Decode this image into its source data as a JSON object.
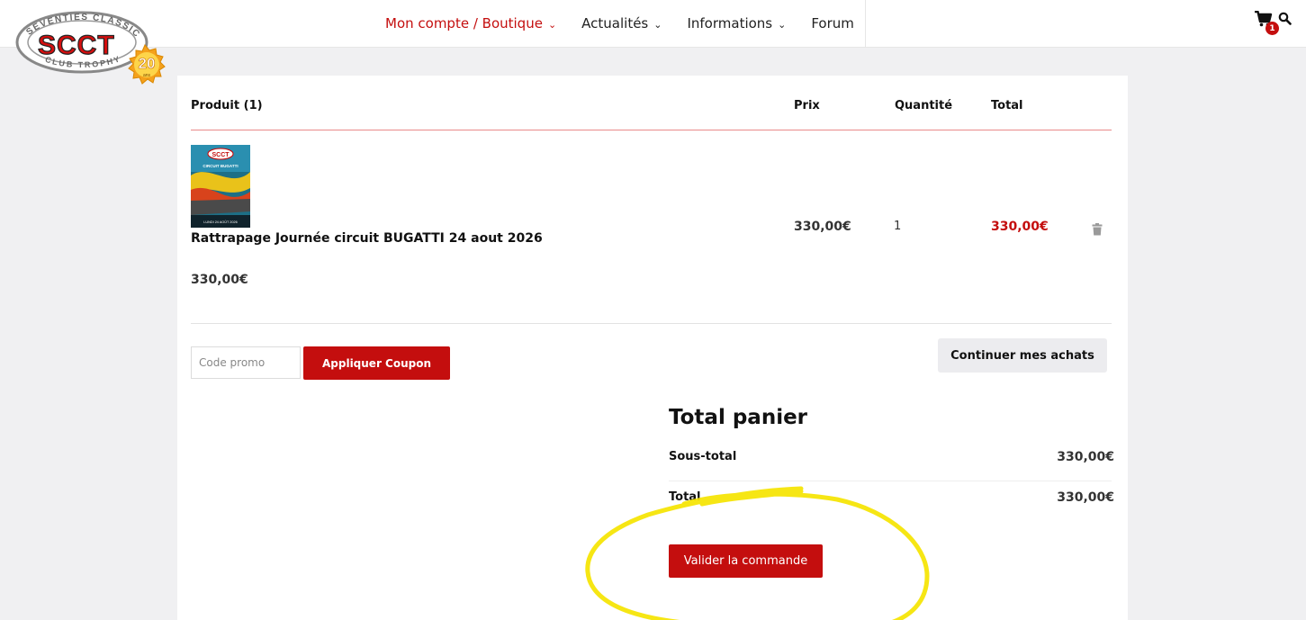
{
  "brand": {
    "logo_text": "SCCT",
    "logo_ring_top": "SEVENTIES CLASSIC",
    "logo_ring_bottom": "CLUB TROPHY",
    "anniversary": "20",
    "anniversary_sub": "ans"
  },
  "nav": {
    "items": [
      {
        "label": "Mon compte / Boutique",
        "active": true,
        "chevron": true
      },
      {
        "label": "Actualités",
        "active": false,
        "chevron": true
      },
      {
        "label": "Informations",
        "active": false,
        "chevron": true
      },
      {
        "label": "Forum",
        "active": false,
        "chevron": false
      }
    ]
  },
  "header_icons": {
    "cart_icon": "cart-icon",
    "cart_count": "1",
    "search_icon": "search-icon"
  },
  "table": {
    "headers": {
      "product": "Produit (1)",
      "price": "Prix",
      "quantity": "Quantité",
      "total": "Total"
    },
    "row": {
      "name": "Rattrapage Journée circuit BUGATTI 24 aout 2026",
      "unit_price_below": "330,00€",
      "price": "330,00€",
      "quantity": "1",
      "total": "330,00€",
      "thumb_title": "SCCT",
      "thumb_sub": "CIRCUIT BUGATTI",
      "thumb_date": "LUNDI 24 AOÛT 2026"
    }
  },
  "coupon": {
    "placeholder": "Code promo",
    "apply_label": "Appliquer Coupon"
  },
  "continue_label": "Continuer mes achats",
  "totals": {
    "title": "Total panier",
    "subtotal_label": "Sous-total",
    "subtotal_value": "330,00€",
    "total_label": "Total",
    "total_value": "330,00€",
    "checkout_label": "Valider la commande"
  },
  "colors": {
    "accent": "#c40e0e",
    "annotation": "#f5e400",
    "background": "#f0f0f2"
  }
}
